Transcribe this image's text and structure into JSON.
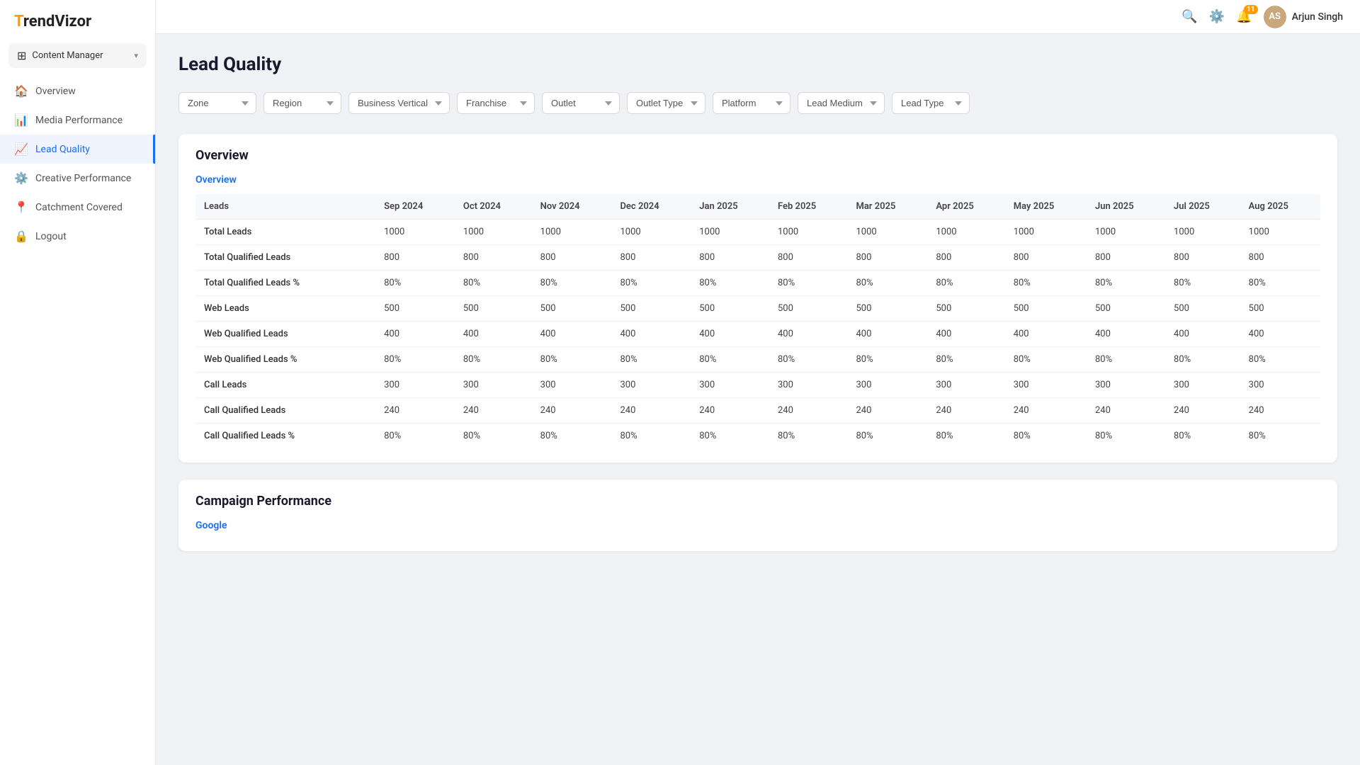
{
  "logo": {
    "prefix": "T",
    "suffix": "rendVizor"
  },
  "content_manager": {
    "label": "Content Manager",
    "chevron": "▾"
  },
  "nav": {
    "items": [
      {
        "id": "overview",
        "label": "Overview",
        "icon": "🏠",
        "active": false
      },
      {
        "id": "media-performance",
        "label": "Media Performance",
        "icon": "📊",
        "active": false
      },
      {
        "id": "lead-quality",
        "label": "Lead Quality",
        "icon": "📈",
        "active": true
      },
      {
        "id": "creative-performance",
        "label": "Creative Performance",
        "icon": "⚙️",
        "active": false
      },
      {
        "id": "catchment-covered",
        "label": "Catchment Covered",
        "icon": "📍",
        "active": false
      },
      {
        "id": "logout",
        "label": "Logout",
        "icon": "🔒",
        "active": false
      }
    ]
  },
  "topbar": {
    "search_icon": "🔍",
    "settings_icon": "⚙️",
    "notification_count": "11",
    "user_name": "Arjun Singh",
    "user_initials": "AS"
  },
  "filters": [
    {
      "id": "zone",
      "label": "Zone",
      "placeholder": "Zone"
    },
    {
      "id": "region",
      "label": "Region",
      "placeholder": "Region"
    },
    {
      "id": "business-vertical",
      "label": "Business Vertical",
      "placeholder": "Business Vertical"
    },
    {
      "id": "franchise",
      "label": "Franchise",
      "placeholder": "Franchise"
    },
    {
      "id": "outlet",
      "label": "Outlet",
      "placeholder": "Outlet"
    },
    {
      "id": "outlet-type",
      "label": "Outlet Type",
      "placeholder": "Outlet Type"
    },
    {
      "id": "platform",
      "label": "Platform",
      "placeholder": "Platform"
    },
    {
      "id": "lead-medium",
      "label": "Lead Medium",
      "placeholder": "Lead Medium"
    },
    {
      "id": "lead-type",
      "label": "Lead Type",
      "placeholder": "Lead Type"
    }
  ],
  "page_title": "Lead Quality",
  "overview_section": {
    "title": "Overview",
    "subsection": "Overview",
    "columns": [
      "Leads",
      "Sep 2024",
      "Oct 2024",
      "Nov 2024",
      "Dec 2024",
      "Jan 2025",
      "Feb 2025",
      "Mar 2025",
      "Apr 2025",
      "May 2025",
      "Jun 2025",
      "Jul 2025",
      "Aug 2025"
    ],
    "rows": [
      {
        "label": "Total Leads",
        "values": [
          "1000",
          "1000",
          "1000",
          "1000",
          "1000",
          "1000",
          "1000",
          "1000",
          "1000",
          "1000",
          "1000",
          "1000"
        ]
      },
      {
        "label": "Total Qualified Leads",
        "values": [
          "800",
          "800",
          "800",
          "800",
          "800",
          "800",
          "800",
          "800",
          "800",
          "800",
          "800",
          "800"
        ]
      },
      {
        "label": "Total Qualified Leads %",
        "values": [
          "80%",
          "80%",
          "80%",
          "80%",
          "80%",
          "80%",
          "80%",
          "80%",
          "80%",
          "80%",
          "80%",
          "80%"
        ]
      },
      {
        "label": "Web Leads",
        "values": [
          "500",
          "500",
          "500",
          "500",
          "500",
          "500",
          "500",
          "500",
          "500",
          "500",
          "500",
          "500"
        ]
      },
      {
        "label": "Web Qualified Leads",
        "values": [
          "400",
          "400",
          "400",
          "400",
          "400",
          "400",
          "400",
          "400",
          "400",
          "400",
          "400",
          "400"
        ]
      },
      {
        "label": "Web Qualified Leads %",
        "values": [
          "80%",
          "80%",
          "80%",
          "80%",
          "80%",
          "80%",
          "80%",
          "80%",
          "80%",
          "80%",
          "80%",
          "80%"
        ]
      },
      {
        "label": "Call Leads",
        "values": [
          "300",
          "300",
          "300",
          "300",
          "300",
          "300",
          "300",
          "300",
          "300",
          "300",
          "300",
          "300"
        ]
      },
      {
        "label": "Call Qualified Leads",
        "values": [
          "240",
          "240",
          "240",
          "240",
          "240",
          "240",
          "240",
          "240",
          "240",
          "240",
          "240",
          "240"
        ]
      },
      {
        "label": "Call Qualified Leads %",
        "values": [
          "80%",
          "80%",
          "80%",
          "80%",
          "80%",
          "80%",
          "80%",
          "80%",
          "80%",
          "80%",
          "80%",
          "80%"
        ]
      }
    ]
  },
  "campaign_section": {
    "title": "Campaign Performance",
    "google_label": "Google"
  }
}
